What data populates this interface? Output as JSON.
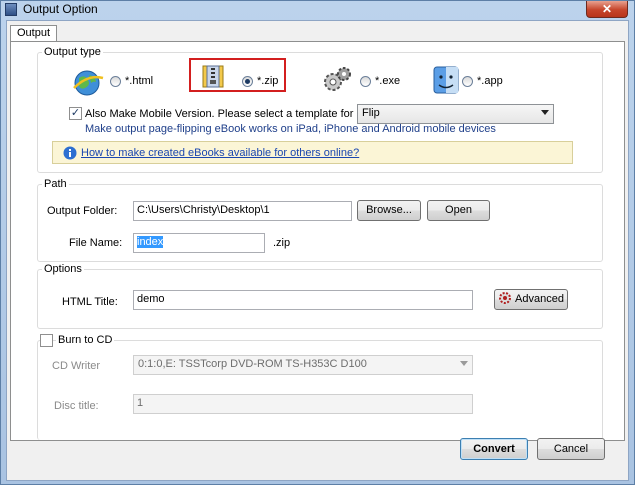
{
  "window": {
    "title": "Output Option",
    "close_label": "✕"
  },
  "tab": {
    "label": "Output"
  },
  "output_type": {
    "label": "Output type",
    "options": [
      {
        "label": "*.html",
        "checked": false
      },
      {
        "label": "*.zip",
        "checked": true
      },
      {
        "label": "*.exe",
        "checked": false
      },
      {
        "label": "*.app",
        "checked": false
      }
    ],
    "mobile_checkbox_label": "Also Make Mobile Version. Please select a template for mobile:",
    "mobile_checked": true,
    "template_value": "Flip",
    "mobile_note": "Make output page-flipping eBook works on iPad, iPhone and Android mobile devices",
    "help_link": "How to make created eBooks available for others online?"
  },
  "path": {
    "label": "Path",
    "output_folder_label": "Output Folder:",
    "output_folder_value": "C:\\Users\\Christy\\Desktop\\1",
    "browse_label": "Browse...",
    "open_label": "Open",
    "file_name_label": "File Name:",
    "file_name_value": "index",
    "file_ext": ".zip"
  },
  "options": {
    "label": "Options",
    "html_title_label": "HTML Title:",
    "html_title_value": "demo",
    "advanced_label": "Advanced"
  },
  "burn": {
    "label": "Burn to CD",
    "checked": false,
    "cd_writer_label": "CD Writer",
    "cd_writer_value": "0:1:0,E: TSSTcorp DVD-ROM TS-H353C D100",
    "disc_title_label": "Disc title:",
    "disc_title_value": "1"
  },
  "footer": {
    "convert_label": "Convert",
    "cancel_label": "Cancel"
  },
  "icons": [
    "window-app-icon",
    "globe-icon",
    "zip-archive-icon",
    "exe-gears-icon",
    "mac-finder-icon",
    "info-icon",
    "advanced-settings-icon"
  ]
}
